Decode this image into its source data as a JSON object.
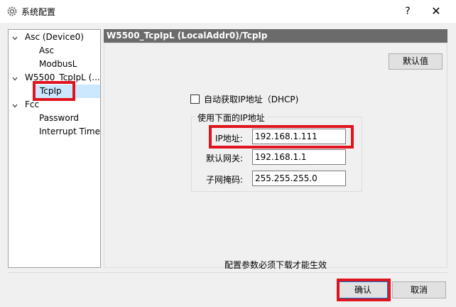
{
  "window": {
    "title": "系统配置",
    "help_label": "?",
    "close_label": "✕"
  },
  "tree": {
    "nodes": [
      {
        "label": "Asc (Device0)",
        "level": 0,
        "expanded": true
      },
      {
        "label": "Asc",
        "level": 1
      },
      {
        "label": "ModbusL",
        "level": 1
      },
      {
        "label": "W5500_TcpIpL (...",
        "level": 0,
        "expanded": true
      },
      {
        "label": "TcpIp",
        "level": 1,
        "selected": true
      },
      {
        "label": "Fcc",
        "level": 0,
        "expanded": true
      },
      {
        "label": "Password",
        "level": 1
      },
      {
        "label": "Interrupt Time",
        "level": 1
      }
    ]
  },
  "panel": {
    "header": "W5500_TcpIpL (LocalAddr0)/TcpIp",
    "default_button": "默认值",
    "dhcp_label": "自动获取IP地址（DHCP)",
    "dhcp_checked": false,
    "group_title": "使用下面的IP地址",
    "fields": [
      {
        "label": "IP地址:",
        "value": "192.168.1.111"
      },
      {
        "label": "默认网关:",
        "value": "192.168.1.1"
      },
      {
        "label": "子网掩码:",
        "value": "255.255.255.0"
      }
    ],
    "footnote": "配置参数必须下载才能生效"
  },
  "buttons": {
    "ok": "确认",
    "cancel": "取消"
  },
  "colors": {
    "header_bg": "#6b6b6b",
    "highlight": "#e0141e",
    "selection": "#cce8ff",
    "ok_border": "#0078d7"
  }
}
